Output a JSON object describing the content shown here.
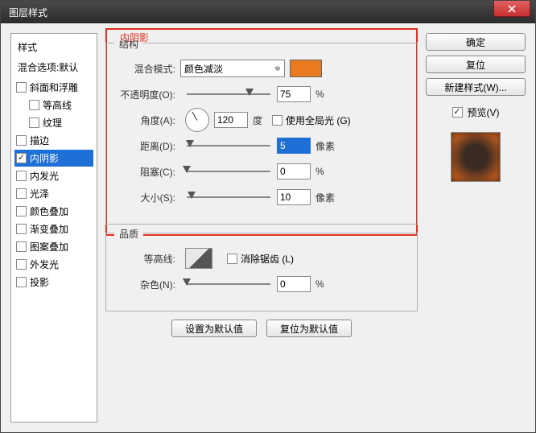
{
  "window": {
    "title": "图层样式"
  },
  "sidebar": {
    "header": "样式",
    "sub": "混合选项:默认",
    "items": [
      {
        "label": "斜面和浮雕",
        "checked": false,
        "selected": false,
        "indent": false
      },
      {
        "label": "等高线",
        "checked": false,
        "selected": false,
        "indent": true
      },
      {
        "label": "纹理",
        "checked": false,
        "selected": false,
        "indent": true
      },
      {
        "label": "描边",
        "checked": false,
        "selected": false,
        "indent": false
      },
      {
        "label": "内阴影",
        "checked": true,
        "selected": true,
        "indent": false
      },
      {
        "label": "内发光",
        "checked": false,
        "selected": false,
        "indent": false
      },
      {
        "label": "光泽",
        "checked": false,
        "selected": false,
        "indent": false
      },
      {
        "label": "颜色叠加",
        "checked": false,
        "selected": false,
        "indent": false
      },
      {
        "label": "渐变叠加",
        "checked": false,
        "selected": false,
        "indent": false
      },
      {
        "label": "图案叠加",
        "checked": false,
        "selected": false,
        "indent": false
      },
      {
        "label": "外发光",
        "checked": false,
        "selected": false,
        "indent": false
      },
      {
        "label": "投影",
        "checked": false,
        "selected": false,
        "indent": false
      }
    ]
  },
  "panel": {
    "red_label": "内阴影",
    "structure": {
      "legend": "结构",
      "blend_mode_label": "混合模式:",
      "blend_mode_value": "颜色减淡",
      "color": "#e97a1f",
      "opacity_label": "不透明度(O):",
      "opacity_value": "75",
      "opacity_unit": "%",
      "angle_label": "角度(A):",
      "angle_value": "120",
      "angle_unit": "度",
      "global_light_label": "使用全局光 (G)",
      "global_light_checked": false,
      "distance_label": "距离(D):",
      "distance_value": "5",
      "distance_unit": "像素",
      "choke_label": "阻塞(C):",
      "choke_value": "0",
      "choke_unit": "%",
      "size_label": "大小(S):",
      "size_value": "10",
      "size_unit": "像素"
    },
    "quality": {
      "legend": "品质",
      "contour_label": "等高线:",
      "antialias_label": "消除锯齿 (L)",
      "antialias_checked": false,
      "noise_label": "杂色(N):",
      "noise_value": "0",
      "noise_unit": "%"
    },
    "buttons": {
      "default": "设置为默认值",
      "reset": "复位为默认值"
    }
  },
  "right": {
    "ok": "确定",
    "cancel": "复位",
    "new_style": "新建样式(W)...",
    "preview_label": "预览(V)",
    "preview_checked": true
  }
}
